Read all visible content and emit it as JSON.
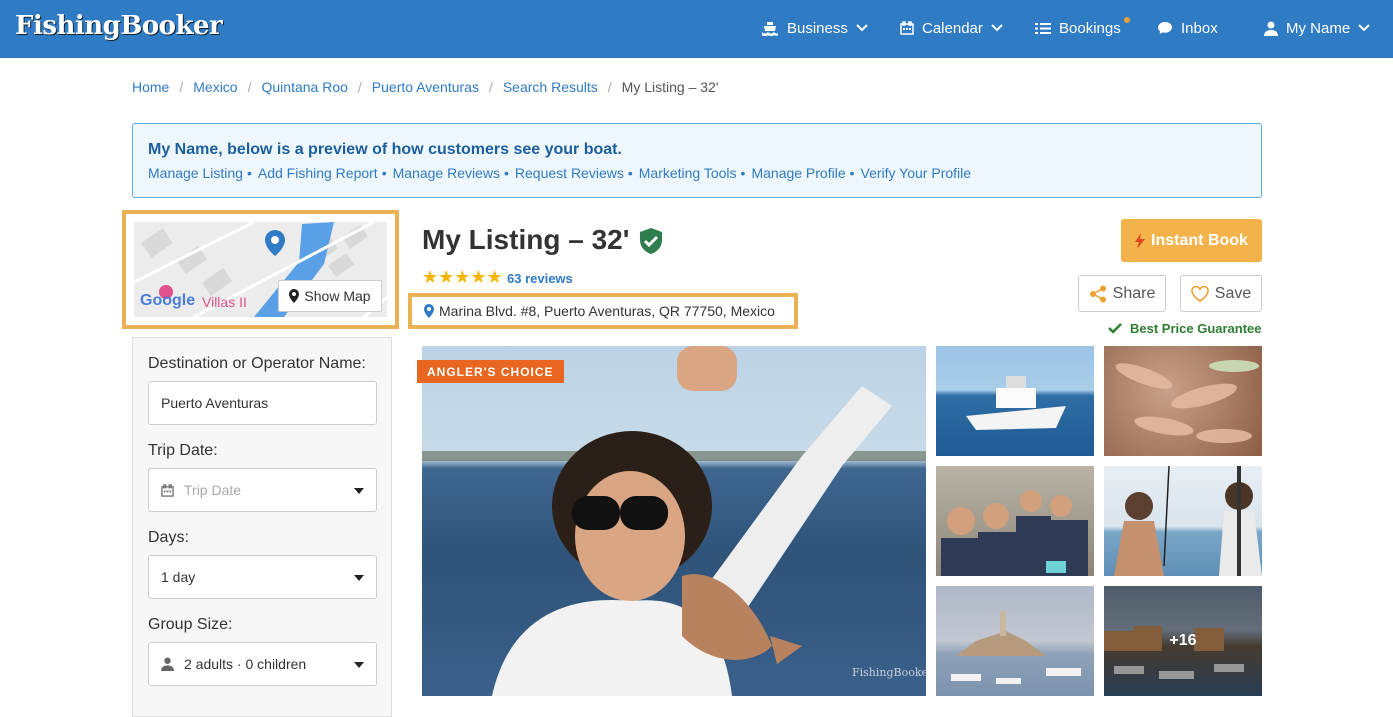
{
  "brand": "FishingBooker",
  "nav": {
    "business": "Business",
    "calendar": "Calendar",
    "bookings": "Bookings",
    "inbox": "Inbox",
    "account": "My Name"
  },
  "breadcrumb": [
    "Home",
    "Mexico",
    "Quintana Roo",
    "Puerto Aventuras",
    "Search Results",
    "My Listing – 32'"
  ],
  "preview": {
    "title": "My Name, below is a preview of how customers see your boat.",
    "links": [
      "Manage Listing",
      "Add Fishing Report",
      "Manage Reviews",
      "Request Reviews",
      "Marketing Tools",
      "Manage Profile",
      "Verify Your Profile"
    ]
  },
  "map": {
    "show_map": "Show Map",
    "google": "Google",
    "poi": "Villas II"
  },
  "search": {
    "destination_label": "Destination or Operator Name:",
    "destination_value": "Puerto Aventuras",
    "date_label": "Trip Date:",
    "date_placeholder": "Trip Date",
    "days_label": "Days:",
    "days_value": "1 day",
    "group_label": "Group Size:",
    "group_value": "2 adults · 0 children"
  },
  "listing": {
    "title": "My Listing – 32'",
    "stars": "★★★★★",
    "rating": 5,
    "reviews": "63 reviews",
    "address": "Marina Blvd. #8, Puerto Aventuras, QR 77750, Mexico",
    "instant_book": "Instant Book",
    "share": "Share",
    "save": "Save",
    "guarantee": "Best Price Guarantee",
    "badge": "ANGLER'S CHOICE",
    "more_photos": "+16",
    "watermark": "FishingBooker"
  },
  "colors": {
    "header": "#2f7bc4",
    "highlight": "#ebb155",
    "instant": "#f4b34a",
    "badge": "#e8661f",
    "guarantee": "#2e7d32"
  }
}
